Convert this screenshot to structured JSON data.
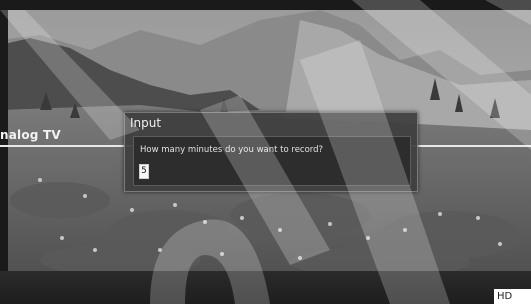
{
  "overlay": {
    "channel_label": "nalog TV",
    "badge": "HD"
  },
  "dialog": {
    "title": "Input",
    "prompt": "How many minutes do you want to record?",
    "value": "5"
  },
  "colors": {
    "dialog_bg": "#3e3e3e",
    "dialog_border": "#7a7a7a",
    "info_line": "#e8e8e8",
    "badge_bg": "#ffffff"
  },
  "icons": [
    "watermark-mark"
  ]
}
